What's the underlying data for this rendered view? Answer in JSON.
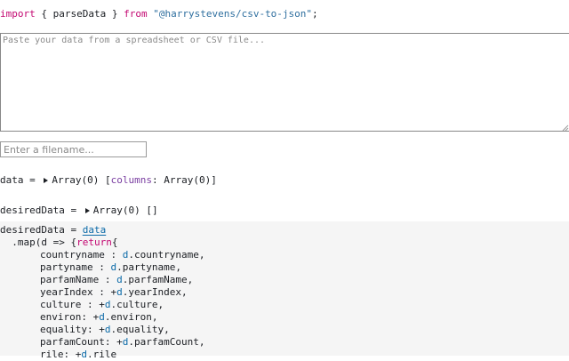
{
  "import_line": {
    "kw_import": "import",
    "open_brace": " { ",
    "name": "parseData",
    "close_brace": " } ",
    "kw_from": "from",
    "module": "\"@harrystevens/csv-to-json\"",
    "semicolon": ";"
  },
  "csv_input": {
    "placeholder": "Paste your data from a spreadsheet or CSV file...",
    "value": ""
  },
  "filename_input": {
    "placeholder": "Enter a filename...",
    "value": ""
  },
  "data_cell": {
    "name": "data",
    "eq": " = ",
    "type": "Array(0)",
    "open": " [",
    "key": "columns",
    "sep": ": ",
    "val": "Array(0)",
    "close": "]"
  },
  "desired_cell": {
    "name": "desiredData",
    "eq": " = ",
    "type": "Array(0)",
    "brackets": " []"
  },
  "code_cell": {
    "line1_name": "desiredData",
    "line1_eq": " = ",
    "line1_ref": "data",
    "line2_a": "  .map(d => {",
    "line2_kw": "return",
    "line2_b": "{",
    "rows": [
      {
        "key": "countryname ",
        "sep": ": ",
        "plus": "",
        "obj": "d",
        "field": ".countryname,"
      },
      {
        "key": "partyname ",
        "sep": ": ",
        "plus": "",
        "obj": "d",
        "field": ".partyname,"
      },
      {
        "key": "parfamName ",
        "sep": ": ",
        "plus": "",
        "obj": "d",
        "field": ".parfamName,"
      },
      {
        "key": "yearIndex ",
        "sep": ": ",
        "plus": "+",
        "obj": "d",
        "field": ".yearIndex,"
      },
      {
        "key": "culture ",
        "sep": ": ",
        "plus": "+",
        "obj": "d",
        "field": ".culture,"
      },
      {
        "key": "environ",
        "sep": ": ",
        "plus": "+",
        "obj": "d",
        "field": ".environ,"
      },
      {
        "key": "equality",
        "sep": ": ",
        "plus": "+",
        "obj": "d",
        "field": ".equality,"
      },
      {
        "key": "parfamCount",
        "sep": ": ",
        "plus": "+",
        "obj": "d",
        "field": ".parfamCount,"
      },
      {
        "key": "rile",
        "sep": ": ",
        "plus": "+",
        "obj": "d",
        "field": ".rile"
      }
    ]
  },
  "colors": {
    "keyword": "#c30771",
    "string": "#2f6f9f",
    "variable": "#0b6aa8",
    "attribute": "#7a3ea1",
    "cell_background": "#f5f5f5"
  },
  "icons": {
    "expand": "disclosure-triangle-icon",
    "resize": "resize-grip-icon"
  }
}
